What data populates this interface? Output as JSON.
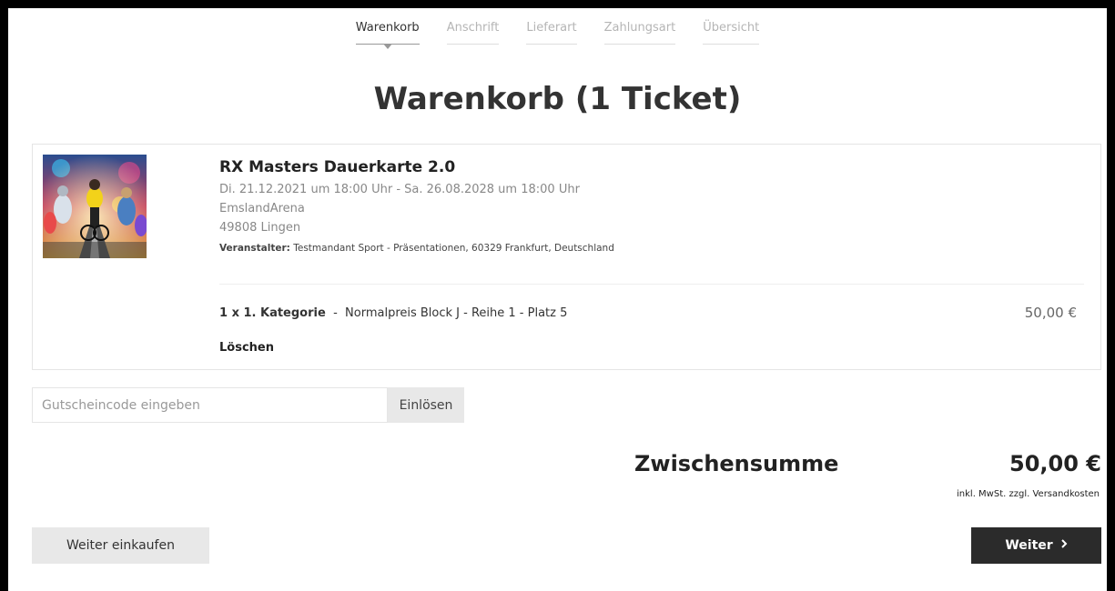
{
  "steps": [
    {
      "label": "Warenkorb",
      "active": true
    },
    {
      "label": "Anschrift",
      "active": false
    },
    {
      "label": "Lieferart",
      "active": false
    },
    {
      "label": "Zahlungsart",
      "active": false
    },
    {
      "label": "Übersicht",
      "active": false
    }
  ],
  "page_title": "Warenkorb (1 Ticket)",
  "event": {
    "title": "RX Masters Dauerkarte 2.0",
    "dates": "Di. 21.12.2021 um 18:00 Uhr - Sa. 26.08.2028 um 18:00 Uhr",
    "venue": "EmslandArena",
    "city": "49808 Lingen",
    "organizer_label": "Veranstalter:",
    "organizer_value": "Testmandant Sport - Präsentationen, 60329 Frankfurt, Deutschland"
  },
  "ticket": {
    "quantity_category": "1 x 1. Kategorie",
    "separator": "-",
    "details": "Normalpreis Block J - Reihe 1 - Platz 5",
    "price": "50,00 €",
    "delete_label": "Löschen"
  },
  "voucher": {
    "placeholder": "Gutscheincode eingeben",
    "value": "",
    "redeem_label": "Einlösen"
  },
  "summary": {
    "label": "Zwischensumme",
    "value": "50,00 €",
    "tax_note": "inkl. MwSt. zzgl. Versandkosten"
  },
  "actions": {
    "continue_shopping": "Weiter einkaufen",
    "next": "Weiter",
    "next_icon": "chevron-right-icon"
  },
  "colors": {
    "primary_button": "#2b2b2b",
    "secondary_button": "#e8e8e8",
    "inactive_step": "#b5b5b5"
  }
}
